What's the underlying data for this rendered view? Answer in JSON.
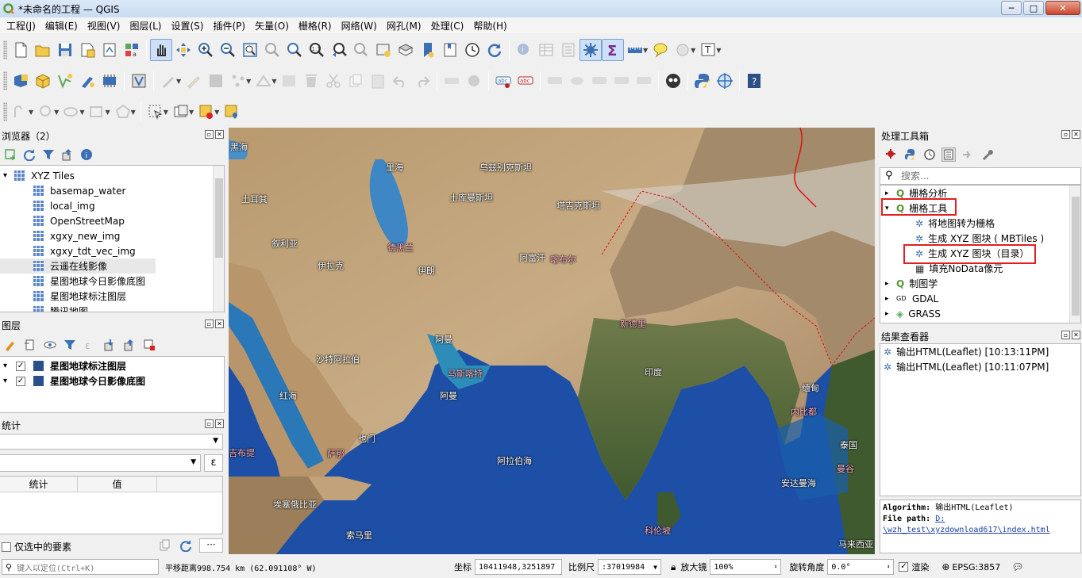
{
  "window": {
    "title": "*未命名的工程 — QGIS",
    "minimize": "─",
    "maximize": "□",
    "close": "✕"
  },
  "menu": [
    "工程(J)",
    "编辑(E)",
    "视图(V)",
    "图层(L)",
    "设置(S)",
    "插件(P)",
    "矢量(O)",
    "栅格(R)",
    "网络(W)",
    "网孔(M)",
    "处理(C)",
    "帮助(H)"
  ],
  "browser": {
    "title": "浏览器（2）",
    "root": "XYZ Tiles",
    "items": [
      "basemap_water",
      "local_img",
      "OpenStreetMap",
      "xgxy_new_img",
      "xgxy_tdt_vec_img",
      "云遥在线影像",
      "星图地球今日影像底图",
      "星图地球标注图层",
      "腾讯地图"
    ],
    "selected_index": 5
  },
  "layers": {
    "title": "图层",
    "items": [
      {
        "name": "星图地球标注图层",
        "checked": true
      },
      {
        "name": "星图地球今日影像底图",
        "checked": true
      }
    ]
  },
  "stats": {
    "title": "统计",
    "expr_button": "ε",
    "col_stat": "统计",
    "col_value": "值",
    "only_selected": "仅选中的要素",
    "more": "···"
  },
  "toolbox": {
    "title": "处理工具箱",
    "search_placeholder": "搜索...",
    "tree": [
      {
        "label": "栅格分析",
        "level": 0,
        "expanded": false
      },
      {
        "label": "栅格工具",
        "level": 0,
        "expanded": true,
        "highlight": true
      },
      {
        "label": "将地图转为栅格",
        "level": 1
      },
      {
        "label": "生成 XYZ 图块 ( MBTiles )",
        "level": 1
      },
      {
        "label": "生成 XYZ 图块（目录）",
        "level": 1,
        "highlight": true
      },
      {
        "label": "填充NoData像元",
        "level": 1
      },
      {
        "label": "制图学",
        "level": 0,
        "expanded": false
      },
      {
        "label": "GDAL",
        "level": 0,
        "expanded": false
      },
      {
        "label": "GRASS",
        "level": 0,
        "expanded": false
      }
    ]
  },
  "results": {
    "title": "结果查看器",
    "items": [
      "输出HTML(Leaflet) [10:13:11PM]",
      "输出HTML(Leaflet) [10:11:07PM]"
    ],
    "log_algorithm_label": "Algorithm:",
    "log_algorithm_value": "输出HTML(Leaflet)",
    "log_path_label": "File path:",
    "log_path_drive": "D:",
    "log_path_rest": "\\wzh_test\\xyzdownload617\\index.html"
  },
  "map_labels": [
    {
      "text": "黑海",
      "color": "white"
    },
    {
      "text": "里海",
      "color": "white"
    },
    {
      "text": "乌兹别克斯坦",
      "color": "white"
    },
    {
      "text": "土耳其",
      "color": "white"
    },
    {
      "text": "土库曼斯坦",
      "color": "white"
    },
    {
      "text": "塔吉克斯坦",
      "color": "white"
    },
    {
      "text": "叙利亚",
      "color": "white"
    },
    {
      "text": "德黑兰",
      "color": "pink"
    },
    {
      "text": "伊拉克",
      "color": "white"
    },
    {
      "text": "阿富汗",
      "color": "white"
    },
    {
      "text": "喀布尔",
      "color": "pink"
    },
    {
      "text": "伊朗",
      "color": "white"
    },
    {
      "text": "新德里",
      "color": "pink"
    },
    {
      "text": "阿曼",
      "color": "white"
    },
    {
      "text": "沙特阿拉伯",
      "color": "white"
    },
    {
      "text": "马斯喀特",
      "color": "pink"
    },
    {
      "text": "印度",
      "color": "white"
    },
    {
      "text": "阿曼",
      "color": "white"
    },
    {
      "text": "缅甸",
      "color": "white"
    },
    {
      "text": "内比都",
      "color": "pink"
    },
    {
      "text": "红海",
      "color": "white"
    },
    {
      "text": "也门",
      "color": "white"
    },
    {
      "text": "萨那",
      "color": "pink"
    },
    {
      "text": "阿拉伯海",
      "color": "white"
    },
    {
      "text": "泰国",
      "color": "white"
    },
    {
      "text": "曼谷",
      "color": "pink"
    },
    {
      "text": "吉布提",
      "color": "pink"
    },
    {
      "text": "埃塞俄比亚",
      "color": "white"
    },
    {
      "text": "安达曼海",
      "color": "white"
    },
    {
      "text": "科伦坡",
      "color": "pink"
    },
    {
      "text": "索马里",
      "color": "white"
    },
    {
      "text": "马来西亚",
      "color": "white"
    }
  ],
  "status": {
    "locate_placeholder": "键入以定位(Ctrl+K)",
    "pan_distance": "平移距离998.754 km (62.091108° W)",
    "coord_label": "坐标",
    "coord_value": "10411948,3251897",
    "scale_label": "比例尺",
    "scale_value": ":37019984",
    "magnifier_label": "放大镜",
    "magnifier_value": "100%",
    "rotation_label": "旋转角度",
    "rotation_value": "0.0°",
    "render_label": "渲染",
    "crs": "EPSG:3857"
  }
}
